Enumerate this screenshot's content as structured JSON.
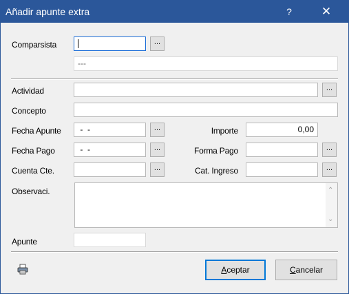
{
  "window": {
    "title": "Añadir apunte extra",
    "help_label": "?",
    "close_label": "✕",
    "title_bar_color": "#2b579a"
  },
  "labels": {
    "comparsista": "Comparsista",
    "actividad": "Actividad",
    "concepto": "Concepto",
    "fecha_apunte": "Fecha Apunte",
    "importe": "Importe",
    "fecha_pago": "Fecha Pago",
    "forma_pago": "Forma Pago",
    "cuenta_cte": "Cuenta Cte.",
    "cat_ingreso": "Cat. Ingreso",
    "observaciones": "Observaci.",
    "apunte": "Apunte"
  },
  "fields": {
    "comparsista": "",
    "comparsista_name": "---",
    "actividad": "",
    "concepto": "",
    "fecha_apunte": " -  -",
    "importe": "0,00",
    "fecha_pago": " -  -",
    "forma_pago": "",
    "cuenta_cte": "",
    "cat_ingreso": "",
    "observaciones": "",
    "apunte": ""
  },
  "ellipsis_label": "...",
  "buttons": {
    "aceptar_underline": "A",
    "aceptar_rest": "ceptar",
    "cancelar_underline": "C",
    "cancelar_rest": "ancelar"
  },
  "icons": {
    "printer": "printer-icon",
    "close": "close-icon",
    "help": "help-icon"
  },
  "accent_color": "#0078d7"
}
